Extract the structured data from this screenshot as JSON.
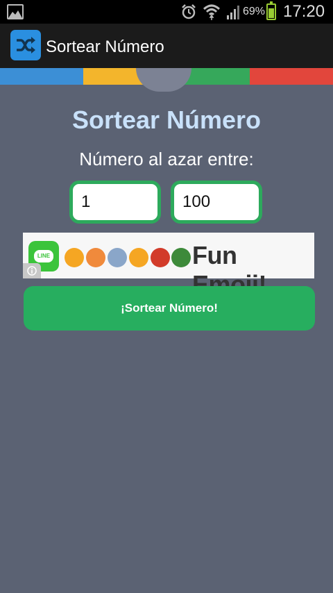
{
  "status_bar": {
    "battery_percent": "69%",
    "time": "17:20",
    "battery_level": 0.69,
    "icons": [
      "gallery-icon",
      "alarm-icon",
      "wifi-icon",
      "signal-icon",
      "battery-icon"
    ]
  },
  "action_bar": {
    "app_icon": "shuffle-icon",
    "title": "Sortear Número"
  },
  "stripe_colors": [
    "#3c8fd6",
    "#f3b52c",
    "#36a85b",
    "#e2463c"
  ],
  "main": {
    "title": "Sortear Número",
    "prompt": "Número al azar entre:",
    "min_value": "1",
    "max_value": "100",
    "button_label": "¡Sortear Número!"
  },
  "ad_banner": {
    "logo_text": "LINE",
    "text": "Fun Emoji!",
    "emoji_colors": [
      "#f5a623",
      "#f08a3c",
      "#8aa6c9",
      "#f5a623",
      "#d23b2a",
      "#3d8a3a"
    ],
    "info_icon": "info-icon"
  },
  "colors": {
    "accent_green": "#27ae5f",
    "title_blue": "#c9e1fa",
    "background": "#5b6273"
  }
}
